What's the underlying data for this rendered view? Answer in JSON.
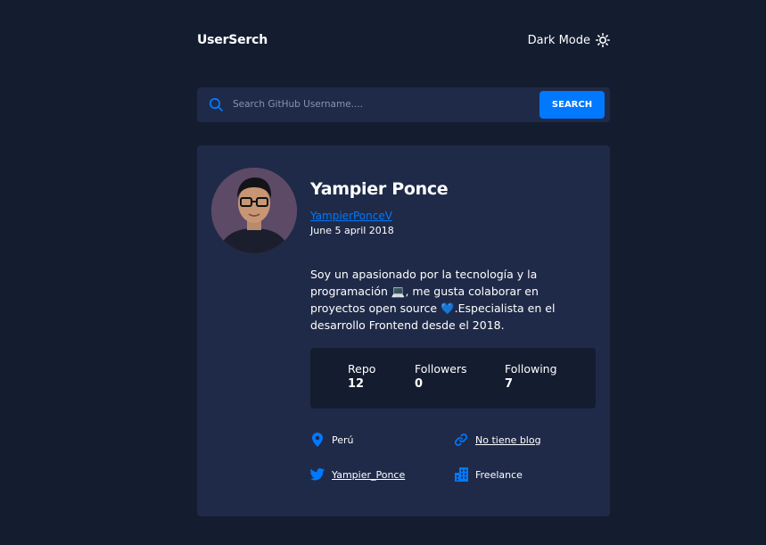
{
  "app": {
    "title": "UserSerch"
  },
  "theme_toggle": {
    "label": "Dark Mode",
    "icon": "sun-icon"
  },
  "search": {
    "placeholder": "Search GitHub Username....",
    "value": "",
    "button_label": "SEARCH"
  },
  "profile": {
    "name": "Yampier Ponce",
    "login": "YampierPonceV",
    "joined": "June 5 april 2018",
    "bio": "Soy un apasionado por la tecnología y la programación 💻, me gusta colaborar en proyectos open source 💙.Especialista en el desarrollo Frontend desde el 2018.",
    "stats": [
      {
        "label": "Repo",
        "value": "12"
      },
      {
        "label": "Followers",
        "value": "0"
      },
      {
        "label": "Following",
        "value": "7"
      }
    ],
    "location": "Perú",
    "blog": "No tiene blog",
    "twitter": "Yampier_Ponce",
    "company": "Freelance"
  },
  "colors": {
    "background": "#141c2f",
    "card": "#1f2a48",
    "accent": "#0079ff"
  }
}
